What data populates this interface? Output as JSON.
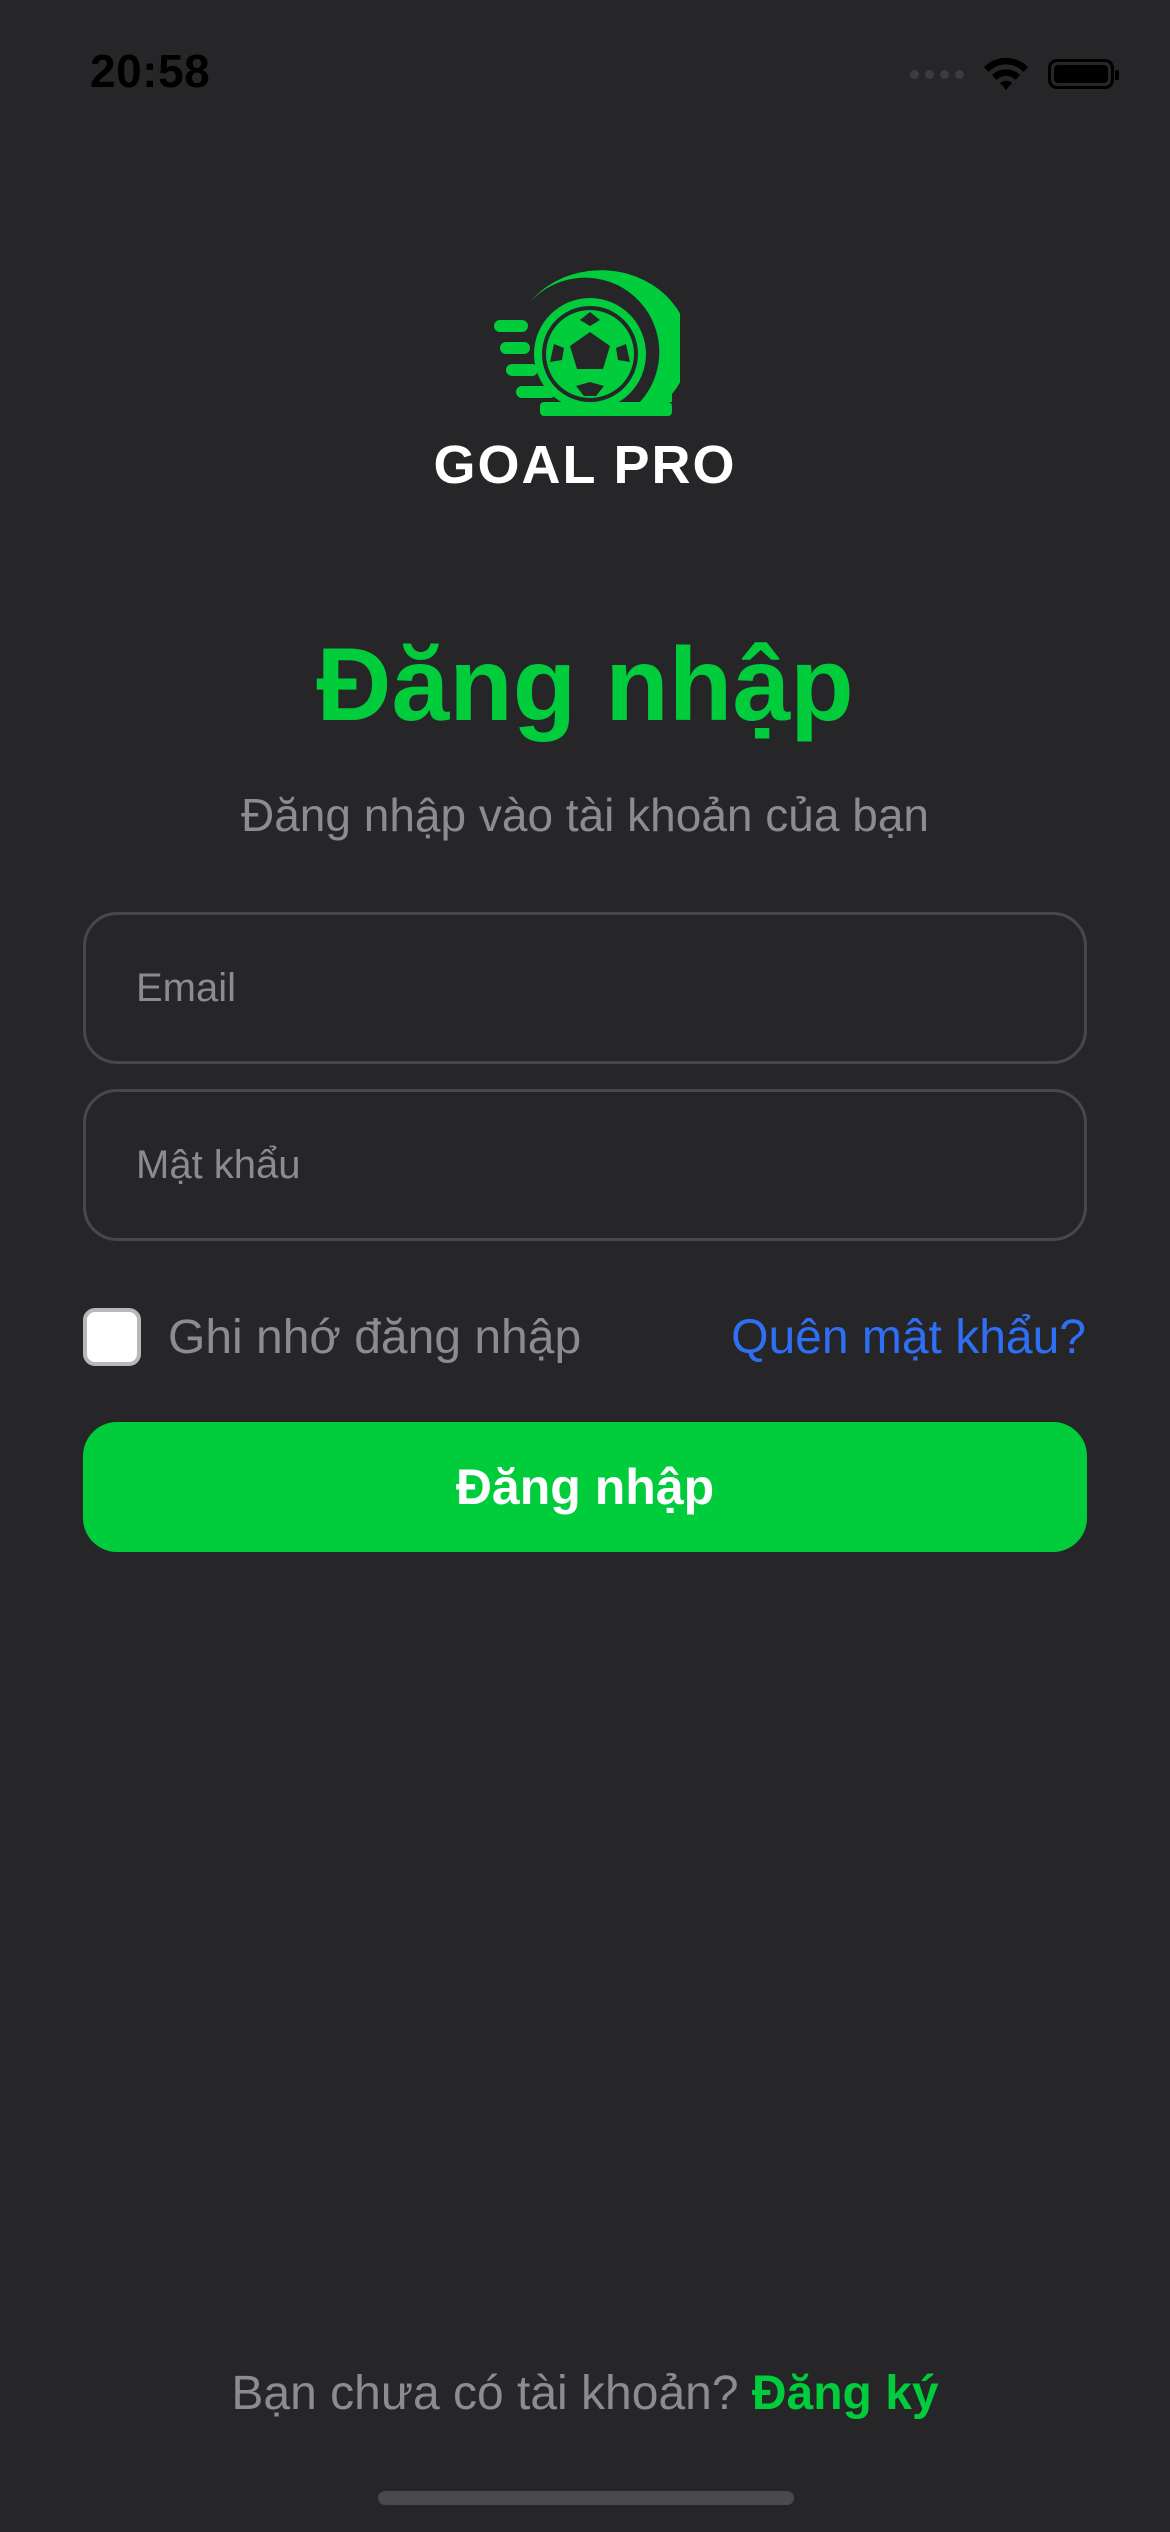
{
  "status_bar": {
    "time": "20:58",
    "icons": [
      "cellular-signal-icon",
      "wifi-icon",
      "battery-icon"
    ]
  },
  "logo": {
    "text": "GOAL PRO",
    "icon": "soccer-ball-logo-icon"
  },
  "login": {
    "title": "Đăng nhập",
    "subtitle": "Đăng nhập vào tài khoản của bạn",
    "email_placeholder": "Email",
    "email_value": "",
    "password_placeholder": "Mật khẩu",
    "password_value": "",
    "remember_label": "Ghi nhớ đăng nhập",
    "remember_checked": false,
    "forgot_label": "Quên mật khẩu?",
    "submit_label": "Đăng nhập"
  },
  "footer": {
    "question": "Bạn chưa có tài khoản?",
    "signup_label": "Đăng ký"
  },
  "colors": {
    "background": "#262628",
    "accent_green": "#00cc3c",
    "link_blue": "#2f6ff5",
    "muted_text": "#8c8c90",
    "field_border": "#48484c"
  }
}
